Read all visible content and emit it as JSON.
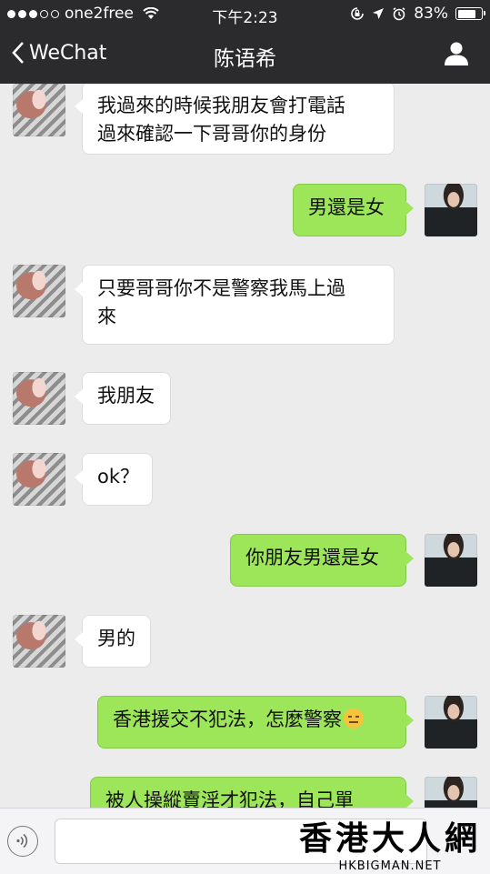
{
  "status_bar": {
    "carrier": "one2free",
    "time": "下午2:23",
    "battery_percent": "83%",
    "battery_level": 0.83,
    "signal_bars": 3
  },
  "nav": {
    "back_label": "WeChat",
    "title": "陈语希"
  },
  "messages": [
    {
      "side": "in",
      "text": "我過來的時候我朋友會打電話\n過來確認一下哥哥你的身份"
    },
    {
      "side": "out",
      "text": "男還是女"
    },
    {
      "side": "in",
      "text": "只要哥哥你不是警察我馬上過\n來"
    },
    {
      "side": "in",
      "text": "我朋友"
    },
    {
      "side": "in",
      "text": "ok？"
    },
    {
      "side": "out",
      "text": "你朋友男還是女"
    },
    {
      "side": "in",
      "text": "男的"
    },
    {
      "side": "out",
      "text": "香港援交不犯法，怎麼警察",
      "emoji": "expressionless-face"
    },
    {
      "side": "out",
      "text": "被人操縱賣淫才犯法，自己單"
    }
  ],
  "watermark": {
    "title": "香港大人網",
    "subtitle": "HKBIGMAN.NET"
  },
  "colors": {
    "bar_bg": "#2b2b2d",
    "chat_bg": "#ececec",
    "bubble_in": "#ffffff",
    "bubble_out": "#9ee659"
  }
}
